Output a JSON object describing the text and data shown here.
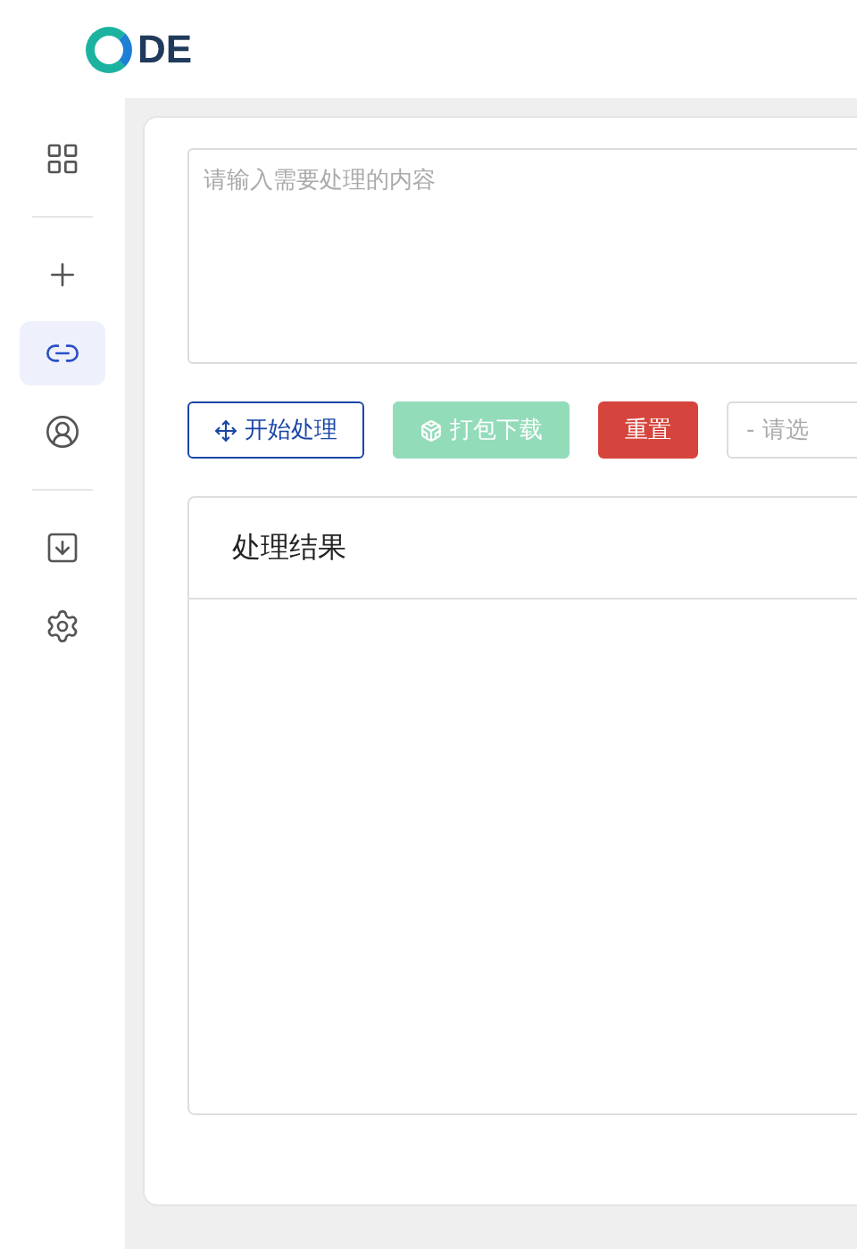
{
  "logo": {
    "text": "DE"
  },
  "sidebar": {
    "items": [
      {
        "kind": "grid",
        "selected": false
      },
      {
        "kind": "divider"
      },
      {
        "kind": "plus",
        "selected": false
      },
      {
        "kind": "link",
        "selected": true
      },
      {
        "kind": "user",
        "selected": false
      },
      {
        "kind": "divider"
      },
      {
        "kind": "download",
        "selected": false
      },
      {
        "kind": "settings",
        "selected": false
      }
    ]
  },
  "input": {
    "placeholder": "请输入需要处理的内容"
  },
  "actions": [
    {
      "kind": "start",
      "label": "开始处理",
      "disabled": false
    },
    {
      "kind": "pack",
      "label": "打包下载",
      "disabled": true
    },
    {
      "kind": "reset",
      "label": "重置",
      "disabled": false
    }
  ],
  "select": {
    "placeholder": "- 请选"
  },
  "result": {
    "title": "处理结果"
  }
}
